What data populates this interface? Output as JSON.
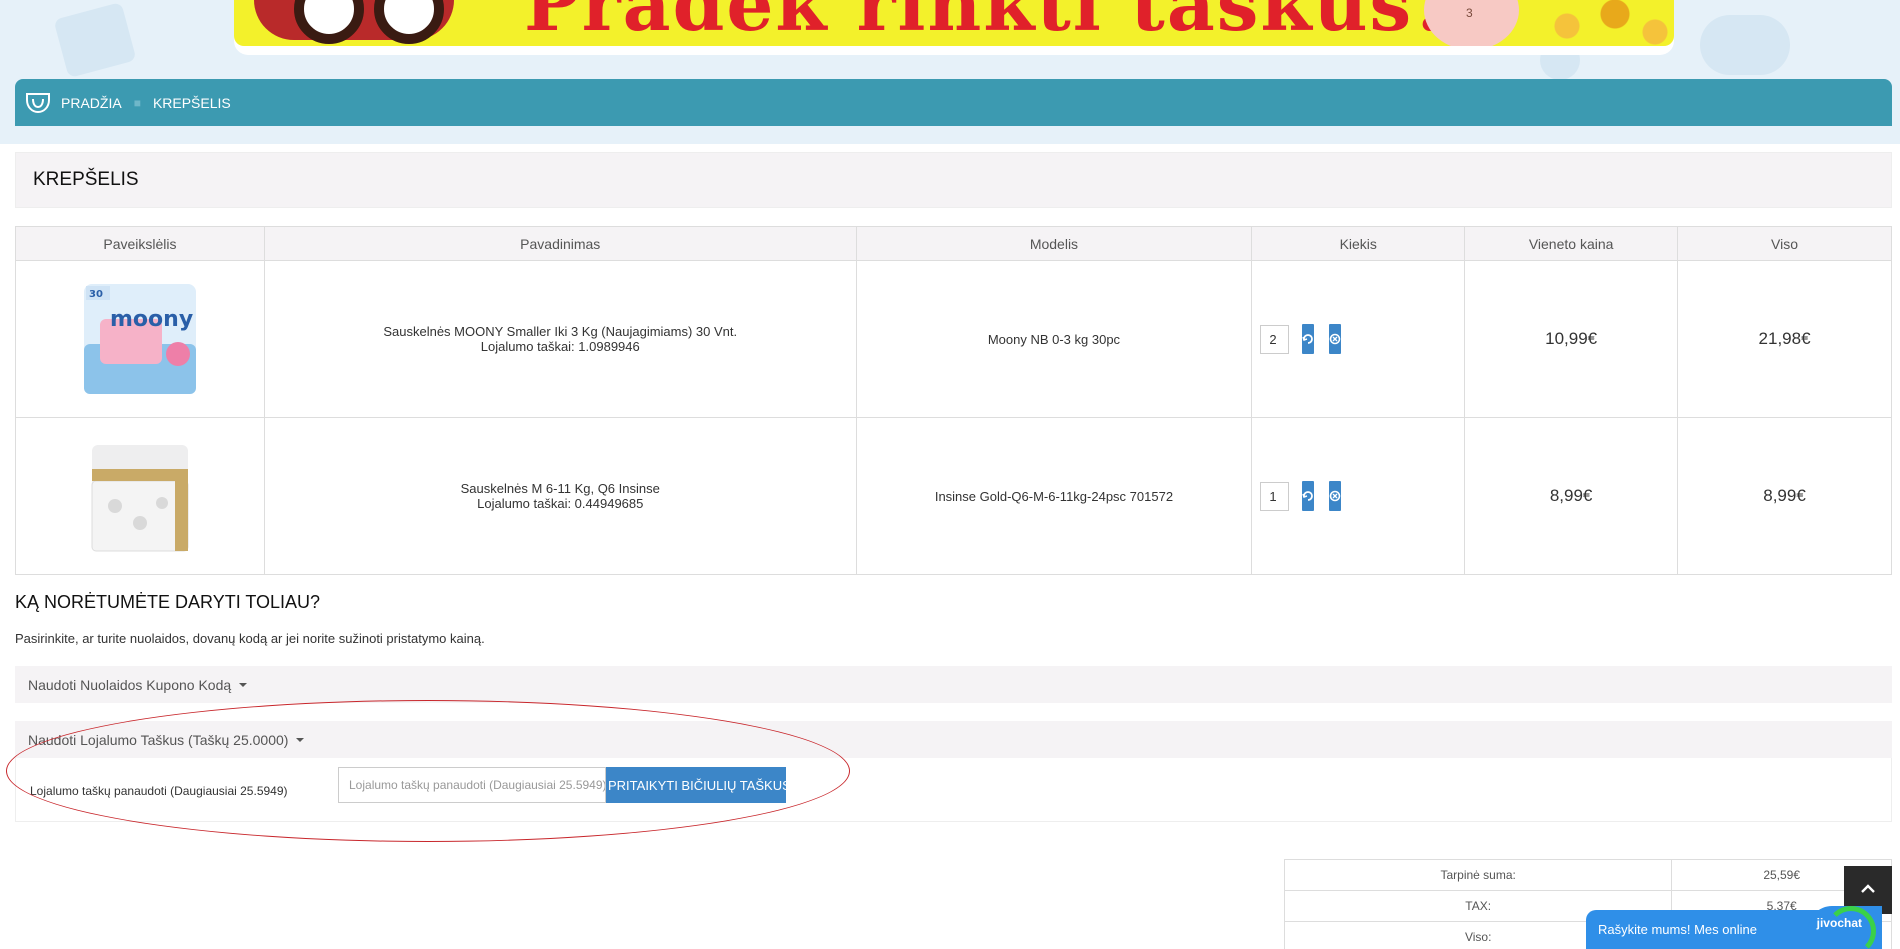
{
  "banner": {
    "title": "Pradėk rinkti taškus!",
    "pig_number": "3"
  },
  "breadcrumb": {
    "home": "PRADŽIA",
    "current": "KREPŠELIS"
  },
  "cart": {
    "heading": "KREPŠELIS",
    "columns": [
      "Paveikslėlis",
      "Pavadinimas",
      "Modelis",
      "Kiekis",
      "Vieneto kaina",
      "Viso"
    ],
    "items": [
      {
        "name": "Sauskelnės MOONY Smaller Iki 3 Kg (Naujagimiams) 30 Vnt.",
        "points": "Lojalumo taškai: 1.0989946",
        "model": "Moony NB 0-3 kg 30pc",
        "qty": "2",
        "unit_price": "10,99€",
        "total": "21,98€",
        "image_brand": "moony",
        "image_count": "30"
      },
      {
        "name": "Sauskelnės M 6-11 Kg, Q6 Insinse",
        "points": "Lojalumo taškai: 0.44949685",
        "model": "Insinse Gold-Q6-M-6-11kg-24psc 701572",
        "qty": "1",
        "unit_price": "8,99€",
        "total": "8,99€"
      }
    ]
  },
  "next": {
    "title": "KĄ NORĖTUMĖTE DARYTI TOLIAU?",
    "description": "Pasirinkite, ar turite nuolaidos, dovanų kodą ar jei norite sužinoti pristatymo kainą.",
    "coupon_label": "Naudoti Nuolaidos Kupono Kodą",
    "loyalty_label": "Naudoti Lojalumo Taškus (Taškų 25.0000)",
    "loyalty_field_label": "Lojalumo taškų panaudoti (Daugiausiai 25.5949)",
    "loyalty_placeholder": "Lojalumo taškų panaudoti (Daugiausiai 25.5949)",
    "apply_button": "PRITAIKYTI BIČIULIŲ TAŠKUS"
  },
  "totals": [
    {
      "label": "Tarpinė suma:",
      "value": "25,59€"
    },
    {
      "label": "TAX:",
      "value": "5,37€"
    },
    {
      "label": "Viso:",
      "value": ""
    }
  ],
  "livechat": {
    "text": "Rašykite mums! Mes online",
    "brand": "jivochat"
  },
  "colors": {
    "accent": "#3c9ab1",
    "button": "#3c86c8",
    "price": "#43aad6",
    "highlight": "#c8272c"
  }
}
